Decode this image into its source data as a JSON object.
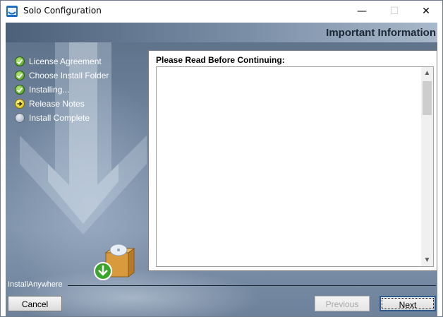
{
  "window": {
    "title": "Solo Configuration",
    "minimize_glyph": "—",
    "maximize_glyph": "☐",
    "close_glyph": "✕"
  },
  "header": {
    "heading": "Important Information"
  },
  "steps": [
    {
      "label": "License Agreement",
      "status": "done"
    },
    {
      "label": "Choose Install Folder",
      "status": "done"
    },
    {
      "label": "Installing...",
      "status": "done"
    },
    {
      "label": "Release Notes",
      "status": "current"
    },
    {
      "label": "Install Complete",
      "status": "pending"
    }
  ],
  "content": {
    "label": "Please Read Before Continuing:",
    "notes_text": ""
  },
  "scrollbar": {
    "up_glyph": "▲",
    "down_glyph": "▼"
  },
  "footer": {
    "brand": "InstallAnywhere",
    "cancel_label": "Cancel",
    "previous_label": "Previous",
    "next_label": "Next"
  },
  "colors": {
    "accent": "#1f6fc2",
    "done": "#3f8e12",
    "current": "#d1b100",
    "pending": "#98a6b6"
  }
}
